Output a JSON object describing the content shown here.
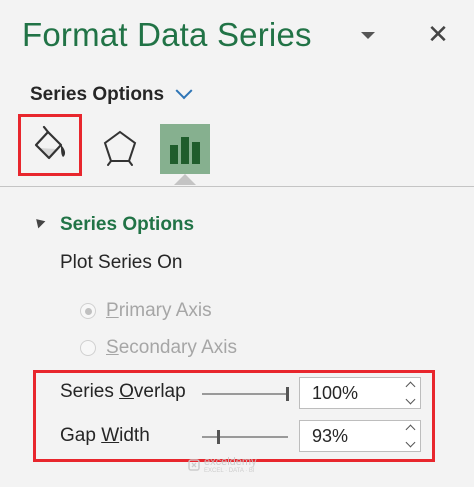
{
  "pane": {
    "title": "Format Data Series",
    "dropdown_icon": "triangle-down-icon",
    "close_glyph": "✕"
  },
  "series_options_dropdown": {
    "label": "Series Options",
    "icon": "chevron-down-icon"
  },
  "tabs": [
    {
      "name": "fill-line",
      "icon": "paint-bucket-icon",
      "highlighted": true
    },
    {
      "name": "effects",
      "icon": "pentagon-icon",
      "highlighted": false
    },
    {
      "name": "series-options",
      "icon": "bar-chart-icon",
      "selected": true
    }
  ],
  "section": {
    "heading": "Series Options",
    "plot_series_on_label": "Plot Series On",
    "primary_axis": {
      "pre": "",
      "ul": "P",
      "post": "rimary Axis",
      "selected": true,
      "disabled": true
    },
    "secondary_axis": {
      "pre": "",
      "ul": "S",
      "post": "econdary Axis",
      "selected": false,
      "disabled": true
    },
    "series_overlap": {
      "pre": "Series ",
      "ul": "O",
      "post": "verlap",
      "value": "100%",
      "fraction": 1.0
    },
    "gap_width": {
      "pre": "Gap ",
      "ul": "W",
      "post": "idth",
      "value": "93%",
      "fraction": 0.186
    }
  },
  "watermark": {
    "name": "exceldemy",
    "tagline": "EXCEL · DATA · BI"
  },
  "colors": {
    "accent_green": "#217346",
    "highlight_red": "#e8262d",
    "selected_tab_bg": "#86b08f",
    "chevron_blue": "#2e75b6"
  }
}
